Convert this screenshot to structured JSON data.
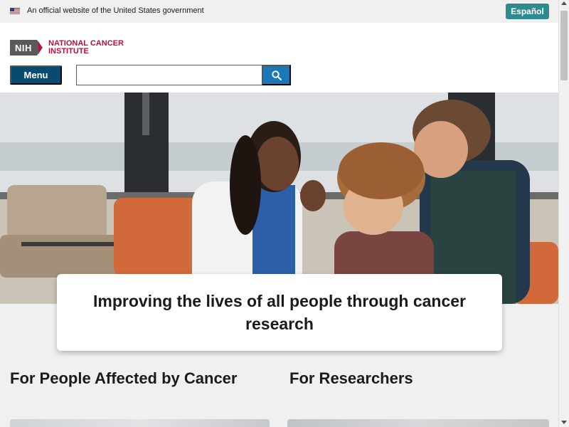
{
  "gov_banner": {
    "text": "An official website of the United States government",
    "flag_icon": "us-flag-icon",
    "language_button": "Español"
  },
  "header": {
    "logo": {
      "nih": "NIH",
      "line1": "NATIONAL CANCER",
      "line2": "INSTITUTE"
    },
    "menu_label": "Menu",
    "search": {
      "value": "",
      "placeholder": "",
      "icon": "search-icon"
    }
  },
  "hero": {
    "image_subject": "doctor-talking-with-family-photo",
    "title": "Improving the lives of all people through cancer research"
  },
  "sections": [
    {
      "heading": "For People Affected by Cancer"
    },
    {
      "heading": "For Researchers"
    }
  ],
  "colors": {
    "brand_red": "#bb0e3d",
    "menu_navy": "#0a4a6e",
    "search_blue": "#1a78b8",
    "language_teal": "#2e8a8f"
  }
}
